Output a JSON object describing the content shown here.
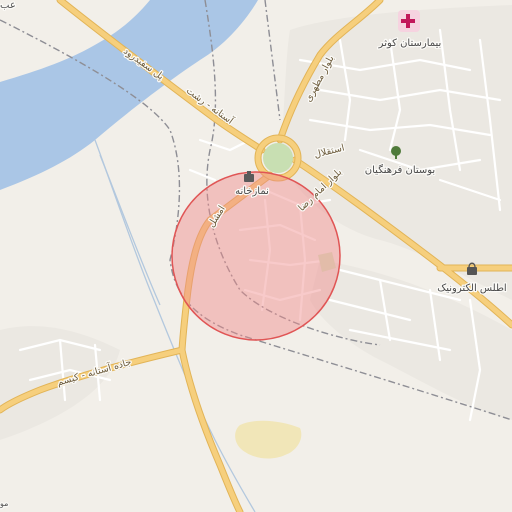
{
  "map": {
    "colors": {
      "land": "#f2efe9",
      "water": "#aac6e6",
      "primary_road": "#f6cf7d",
      "primary_casing": "#e2b457",
      "minor_road": "#ffffff",
      "minor_casing": "#d6d2cb",
      "boundary": "#8e8e95",
      "park": "#c8dfb2",
      "sand": "#f1e6b8",
      "marker_fill": "#f08a8a",
      "marker_stroke": "#e05555"
    },
    "accuracy_marker": {
      "type": "circle",
      "meaning": "location accuracy radius"
    },
    "roads": {
      "north_main": "بلوار مطهری",
      "astaneh_rasht": "آستانه - رشت",
      "sefidrud_bridge": "پل سفیدرود",
      "esteghlal": "استقلال",
      "imam_reza": "بلوار امام رضا",
      "amshal": "امشل",
      "astaneh_kisom": "جاده آستانه - کیسم"
    },
    "pois": [
      {
        "name": "بیمارستان کوثر",
        "icon": "hospital-icon"
      },
      {
        "name": "بوستان فرهنگیان",
        "icon": "park-tree-icon"
      },
      {
        "name": "نمازخانه",
        "icon": "prayer-room-icon"
      },
      {
        "name": "اطلس الکترونیک",
        "icon": "shop-bag-icon"
      }
    ],
    "edge_labels": {
      "top_left": "عب",
      "bottom_left": "مو"
    }
  }
}
